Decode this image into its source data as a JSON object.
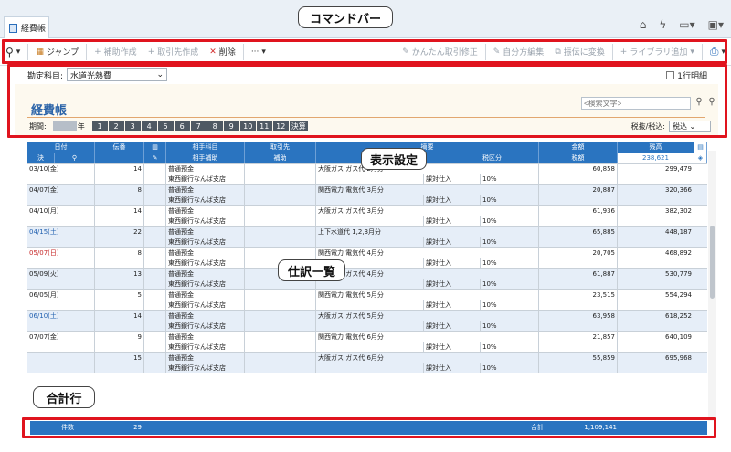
{
  "tab": {
    "label": "経費帳"
  },
  "toolbar": {
    "jump": "ジャンプ",
    "aux_create": "補助作成",
    "partner_create": "取引先作成",
    "delete": "削除",
    "more": "···",
    "simple_fix": "かんたん取引修正",
    "self_edit": "自分方編集",
    "convert": "振伝に変換",
    "library_add": "ライブラリ追加"
  },
  "callouts": {
    "command_bar": "コマンドバー",
    "display_settings": "表示設定",
    "journal_list": "仕訳一覧",
    "total_row": "合計行"
  },
  "filter": {
    "account_label": "勘定科目:",
    "account_value": "水道光熱費",
    "monthly_total": "1行明細"
  },
  "panel": {
    "title": "経費帳",
    "search_placeholder": "<検索文字>",
    "period_label": "期間:",
    "year_suffix": "年",
    "months": [
      "1",
      "2",
      "3",
      "4",
      "5",
      "6",
      "7",
      "8",
      "9",
      "10",
      "11",
      "12",
      "決算"
    ],
    "tax_label": "税抜/税込:",
    "tax_value": "税込"
  },
  "columns": {
    "top": [
      "日付",
      "伝番",
      "",
      "相手科目",
      "取引先",
      "摘要",
      "金額",
      "残高"
    ],
    "bottom": [
      "決",
      "",
      "",
      "相手補助",
      "補助",
      "税区分",
      "税額"
    ],
    "top_balance": "238,621"
  },
  "rows": [
    {
      "date": "03/10(金)",
      "no": "14",
      "acct": "普通預金",
      "desc": "大阪ガス ガス代 2月分",
      "amount": "60,858",
      "balance": "299,479",
      "sub": "東西銀行なんば支店",
      "tax": "課対仕入",
      "rate": "10%",
      "date_color": "#222",
      "bg": "w"
    },
    {
      "date": "04/07(金)",
      "no": "8",
      "acct": "普通預金",
      "desc": "関西電力 電気代 3月分",
      "amount": "20,887",
      "balance": "320,366",
      "sub": "東西銀行なんば支店",
      "tax": "課対仕入",
      "rate": "10%",
      "date_color": "#222",
      "bg": "b"
    },
    {
      "date": "04/10(月)",
      "no": "14",
      "acct": "普通預金",
      "desc": "大阪ガス ガス代 3月分",
      "amount": "61,936",
      "balance": "382,302",
      "sub": "東西銀行なんば支店",
      "tax": "課対仕入",
      "rate": "10%",
      "date_color": "#222",
      "bg": "w"
    },
    {
      "date": "04/15(土)",
      "no": "22",
      "acct": "普通預金",
      "desc": "上下水道代 1,2,3月分",
      "amount": "65,885",
      "balance": "448,187",
      "sub": "東西銀行なんば支店",
      "tax": "課対仕入",
      "rate": "10%",
      "date_color": "#2462b0",
      "bg": "b"
    },
    {
      "date": "05/07(日)",
      "no": "8",
      "acct": "普通預金",
      "desc": "関西電力 電気代 4月分",
      "amount": "20,705",
      "balance": "468,892",
      "sub": "東西銀行なんば支店",
      "tax": "課対仕入",
      "rate": "10%",
      "date_color": "#c62828",
      "bg": "w"
    },
    {
      "date": "05/09(火)",
      "no": "13",
      "acct": "普通預金",
      "desc": "大阪ガス ガス代 4月分",
      "amount": "61,887",
      "balance": "530,779",
      "sub": "東西銀行なんば支店",
      "tax": "課対仕入",
      "rate": "10%",
      "date_color": "#222",
      "bg": "b"
    },
    {
      "date": "06/05(月)",
      "no": "5",
      "acct": "普通預金",
      "desc": "関西電力 電気代 5月分",
      "amount": "23,515",
      "balance": "554,294",
      "sub": "東西銀行なんば支店",
      "tax": "課対仕入",
      "rate": "10%",
      "date_color": "#222",
      "bg": "w"
    },
    {
      "date": "06/10(土)",
      "no": "14",
      "acct": "普通預金",
      "desc": "大阪ガス ガス代 5月分",
      "amount": "63,958",
      "balance": "618,252",
      "sub": "東西銀行なんば支店",
      "tax": "課対仕入",
      "rate": "10%",
      "date_color": "#2462b0",
      "bg": "b"
    },
    {
      "date": "07/07(金)",
      "no": "9",
      "acct": "普通預金",
      "desc": "関西電力 電気代 6月分",
      "amount": "21,857",
      "balance": "640,109",
      "sub": "東西銀行なんば支店",
      "tax": "課対仕入",
      "rate": "10%",
      "date_color": "#222",
      "bg": "w"
    },
    {
      "date": "",
      "no": "15",
      "acct": "普通預金",
      "desc": "大阪ガス ガス代 6月分",
      "amount": "55,859",
      "balance": "695,968",
      "sub": "東西銀行なんば支店",
      "tax": "課対仕入",
      "rate": "10%",
      "date_color": "#222",
      "bg": "b"
    }
  ],
  "footer": {
    "count_label": "件数",
    "count": "29",
    "total_label": "合計",
    "total": "1,109,141"
  }
}
